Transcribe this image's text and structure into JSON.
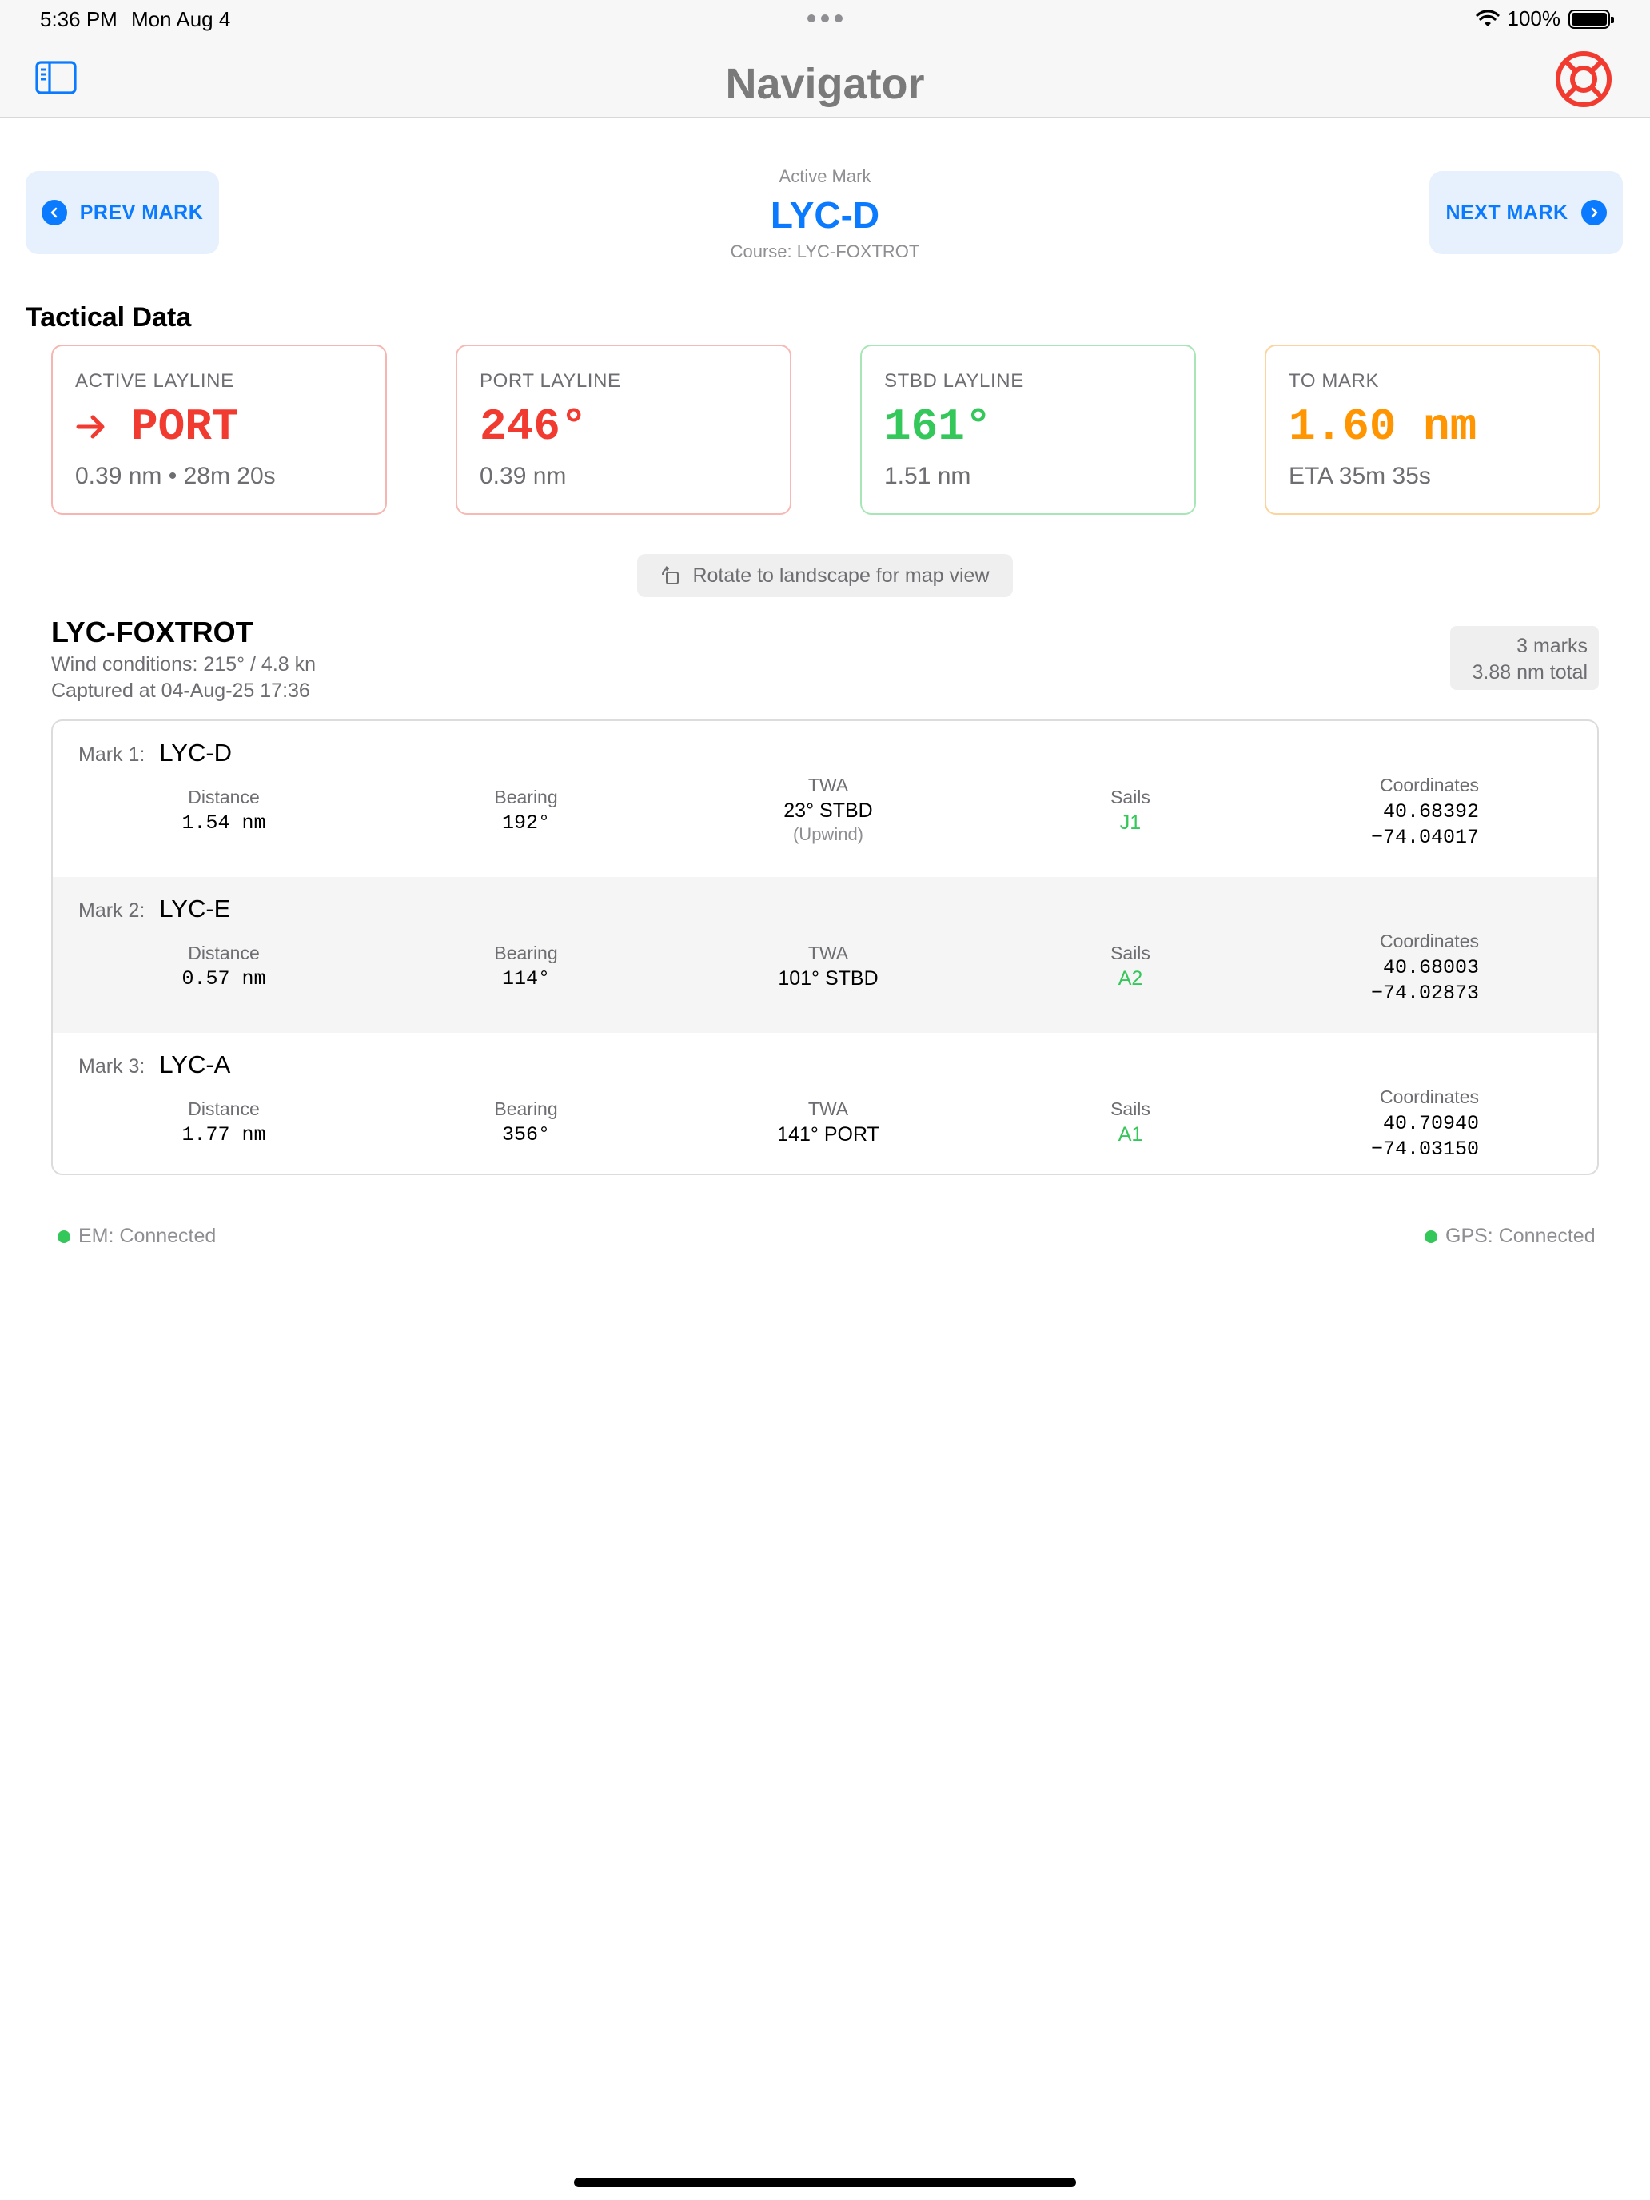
{
  "status_bar": {
    "time": "5:36 PM",
    "date": "Mon Aug 4",
    "battery": "100%",
    "icons": [
      "wifi-icon",
      "battery-icon"
    ]
  },
  "nav": {
    "title": "Navigator",
    "left_icon": "sidebar-icon",
    "right_icon": "lifebuoy-icon"
  },
  "mark_nav": {
    "prev_label": "PREV MARK",
    "next_label": "NEXT MARK",
    "active_label": "Active Mark",
    "active_name": "LYC-D",
    "course": "Course: LYC-FOXTROT"
  },
  "tactical": {
    "title": "Tactical Data",
    "cards": [
      {
        "label": "ACTIVE LAYLINE",
        "value": "PORT",
        "sub": "0.39 nm • 28m 20s",
        "color": "#f23b30",
        "icon": "arrow-right-icon"
      },
      {
        "label": "PORT LAYLINE",
        "value": "246°",
        "sub": "0.39 nm",
        "color": "#f23b30"
      },
      {
        "label": "STBD LAYLINE",
        "value": "161°",
        "sub": "1.51 nm",
        "color": "#34c759"
      },
      {
        "label": "TO MARK",
        "value": "1.60 nm",
        "sub": "ETA 35m 35s",
        "color": "#ff9500"
      }
    ]
  },
  "rotate_hint": {
    "text": "Rotate to landscape for map view",
    "icon": "rotate-icon"
  },
  "course": {
    "name": "LYC-FOXTROT",
    "wind": "Wind conditions: 215° / 4.8 kn",
    "captured": "Captured at 04-Aug-25 17:36",
    "marks_count": "3 marks",
    "total": "3.88 nm total"
  },
  "marks_headers": {
    "distance": "Distance",
    "bearing": "Bearing",
    "twa": "TWA",
    "sails": "Sails",
    "coordinates": "Coordinates"
  },
  "marks": [
    {
      "num": "Mark 1:",
      "name": "LYC-D",
      "distance": "1.54 nm",
      "bearing": "192°",
      "twa": "23° STBD",
      "twa_note": "(Upwind)",
      "sails": "J1",
      "lat": "40.68392",
      "lon": "−74.04017"
    },
    {
      "num": "Mark 2:",
      "name": "LYC-E",
      "distance": "0.57 nm",
      "bearing": "114°",
      "twa": "101° STBD",
      "twa_note": "",
      "sails": "A2",
      "lat": "40.68003",
      "lon": "−74.02873"
    },
    {
      "num": "Mark 3:",
      "name": "LYC-A",
      "distance": "1.77 nm",
      "bearing": "356°",
      "twa": "141° PORT",
      "twa_note": "",
      "sails": "A1",
      "lat": "40.70940",
      "lon": "−74.03150"
    }
  ],
  "connections": {
    "em": "EM: Connected",
    "gps": "GPS: Connected",
    "status_color": "#34c759"
  },
  "colors": {
    "accent": "#0a7aff",
    "red": "#f23b30",
    "green": "#34c759",
    "orange": "#ff9500"
  }
}
